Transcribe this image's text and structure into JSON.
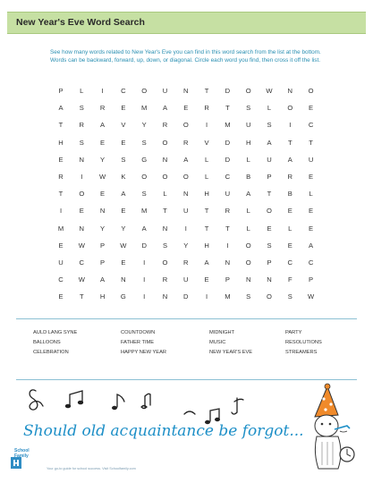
{
  "title": "New Year's Eve Word Search",
  "instructions": "See how many words related to New Year's Eve you can find in this word search from the list at the bottom. Words can be backward, forward, up, down, or diagonal. Circle each word you find, then cross it off the list.",
  "grid": [
    [
      "P",
      "L",
      "I",
      "C",
      "O",
      "U",
      "N",
      "T",
      "D",
      "O",
      "W",
      "N",
      "O"
    ],
    [
      "A",
      "S",
      "R",
      "E",
      "M",
      "A",
      "E",
      "R",
      "T",
      "S",
      "L",
      "O",
      "E"
    ],
    [
      "T",
      "R",
      "A",
      "V",
      "Y",
      "R",
      "O",
      "I",
      "M",
      "U",
      "S",
      "I",
      "C"
    ],
    [
      "H",
      "S",
      "E",
      "E",
      "S",
      "O",
      "R",
      "V",
      "D",
      "H",
      "A",
      "T",
      "T"
    ],
    [
      "E",
      "N",
      "Y",
      "S",
      "G",
      "N",
      "A",
      "L",
      "D",
      "L",
      "U",
      "A",
      "U"
    ],
    [
      "R",
      "I",
      "W",
      "K",
      "O",
      "O",
      "O",
      "L",
      "C",
      "B",
      "P",
      "R",
      "E"
    ],
    [
      "T",
      "O",
      "E",
      "A",
      "S",
      "L",
      "N",
      "H",
      "U",
      "A",
      "T",
      "B",
      "L"
    ],
    [
      "I",
      "E",
      "N",
      "E",
      "M",
      "T",
      "U",
      "T",
      "R",
      "L",
      "O",
      "E",
      "E"
    ],
    [
      "M",
      "N",
      "Y",
      "Y",
      "A",
      "N",
      "I",
      "T",
      "T",
      "L",
      "E",
      "L",
      "E"
    ],
    [
      "E",
      "W",
      "P",
      "W",
      "D",
      "S",
      "Y",
      "H",
      "I",
      "O",
      "S",
      "E",
      "A"
    ],
    [
      "U",
      "C",
      "P",
      "E",
      "I",
      "O",
      "R",
      "A",
      "N",
      "O",
      "P",
      "C",
      "C"
    ],
    [
      "C",
      "W",
      "A",
      "N",
      "I",
      "R",
      "U",
      "E",
      "P",
      "N",
      "N",
      "F",
      "P"
    ],
    [
      "E",
      "T",
      "H",
      "G",
      "I",
      "N",
      "D",
      "I",
      "M",
      "S",
      "O",
      "S",
      "W"
    ]
  ],
  "word_columns": [
    [
      "AULD LANG SYNE",
      "BALLOONS",
      "CELEBRATION"
    ],
    [
      "COUNTDOWN",
      "FATHER TIME",
      "HAPPY NEW YEAR"
    ],
    [
      "MIDNIGHT",
      "MUSIC",
      "NEW YEAR'S EVE"
    ],
    [
      "PARTY",
      "RESOLUTIONS",
      "STREAMERS"
    ]
  ],
  "quote": "Should old acquaintance be forgot...",
  "logo": {
    "line1": "School",
    "line2": "Family"
  },
  "footer": "Your go-to guide for school success. Visit Schoolfamily.com",
  "colors": {
    "title_bar": "#c6e0a3",
    "instructions": "#2a8fb2",
    "quote": "#1d8fc7",
    "logo": "#2f8dc4",
    "hat": "#f08a2a"
  }
}
